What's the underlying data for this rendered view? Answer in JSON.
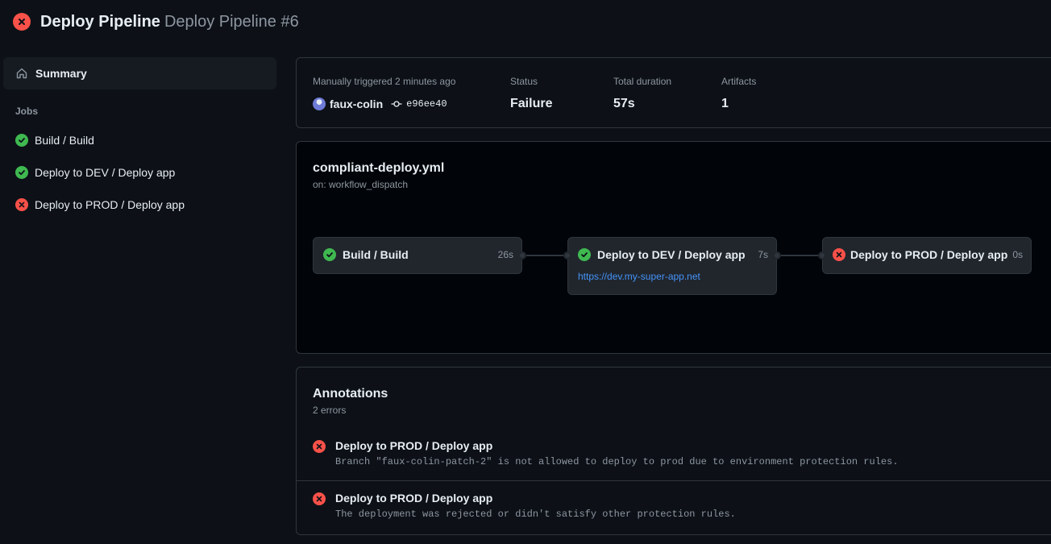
{
  "header": {
    "title": "Deploy Pipeline",
    "subtitle": "Deploy Pipeline #6",
    "status_icon": "x-circle-fill-icon"
  },
  "sidebar": {
    "summary_label": "Summary",
    "jobs_heading": "Jobs",
    "jobs": [
      {
        "label": "Build / Build",
        "status": "success"
      },
      {
        "label": "Deploy to DEV / Deploy app",
        "status": "success"
      },
      {
        "label": "Deploy to PROD / Deploy app",
        "status": "failure"
      }
    ]
  },
  "summary": {
    "trigger_label": "Manually triggered 2 minutes ago",
    "actor": "faux-colin",
    "commit": "e96ee40",
    "status_label": "Status",
    "status_value": "Failure",
    "duration_label": "Total duration",
    "duration_value": "57s",
    "artifacts_label": "Artifacts",
    "artifacts_value": "1"
  },
  "graph": {
    "workflow_file": "compliant-deploy.yml",
    "trigger": "on: workflow_dispatch",
    "nodes": [
      {
        "name": "Build / Build",
        "duration": "26s",
        "status": "success"
      },
      {
        "name": "Deploy to DEV / Deploy app",
        "duration": "7s",
        "status": "success",
        "link": "https://dev.my-super-app.net"
      },
      {
        "name": "Deploy to PROD / Deploy app",
        "duration": "0s",
        "status": "failure"
      }
    ]
  },
  "annotations": {
    "title": "Annotations",
    "count": "2 errors",
    "items": [
      {
        "title": "Deploy to PROD / Deploy app",
        "message": "Branch \"faux-colin-patch-2\" is not allowed to deploy to prod due to environment protection rules."
      },
      {
        "title": "Deploy to PROD / Deploy app",
        "message": "The deployment was rejected or didn't satisfy other protection rules."
      }
    ]
  },
  "colors": {
    "failure": "#f85149",
    "success": "#3fb950",
    "link": "#4493f8",
    "background": "#0d1117"
  }
}
